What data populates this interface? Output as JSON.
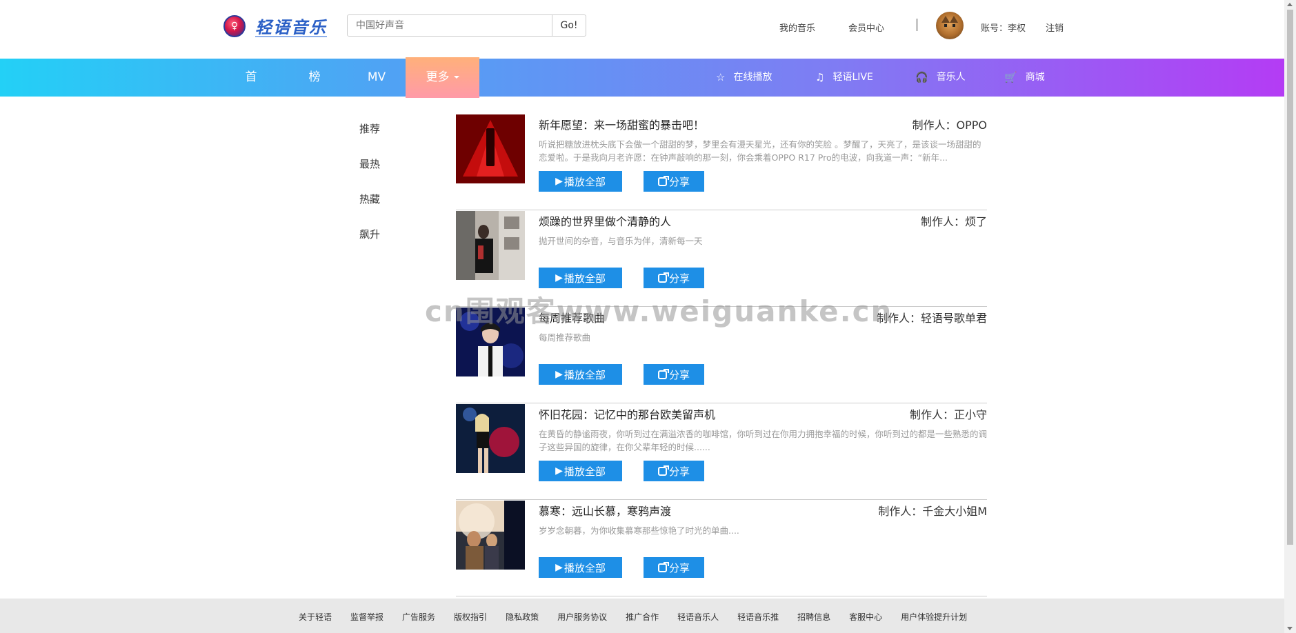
{
  "header": {
    "logo_text": "轻语音乐",
    "logo_glyph": "♀",
    "search_placeholder": "中国好声音",
    "search_button": "Go!",
    "links": {
      "my_music": "我的音乐",
      "member_center": "会员中心",
      "separator": "|",
      "account": "账号：李权",
      "logout": "注销"
    }
  },
  "nav": {
    "items": [
      "首页",
      "榜单",
      "MV"
    ],
    "more": "更多",
    "right": [
      {
        "icon": "star-icon",
        "glyph": "☆",
        "label": "在线播放"
      },
      {
        "icon": "music-note-icon",
        "glyph": "♫",
        "label": "轻语LIVE"
      },
      {
        "icon": "headphones-icon",
        "glyph": "🎧",
        "label": "音乐人"
      },
      {
        "icon": "cart-icon",
        "glyph": "🛒",
        "label": "商城"
      }
    ],
    "gradient": [
      "#23d0f6",
      "#b43cf4"
    ]
  },
  "side_menu": [
    "推荐",
    "最热",
    "热藏",
    "飙升"
  ],
  "playlists": [
    {
      "title": "新年愿望：来一场甜蜜的暴击吧！",
      "producer": "制作人：OPPO",
      "desc": "听说把糖放进枕头底下会做一个甜甜的梦，梦里会有漫天星光，还有你的笑脸 。梦醒了，天亮了，是该谈一场甜甜的恋爱啦。于是我向月老许愿：在钟声敲响的那一刻，你会乘着OPPO R17 Pro的电波，向我道一声：“新年..."
    },
    {
      "title": "烦躁的世界里做个清静的人",
      "producer": "制作人：烦了",
      "desc": "抛开世间的杂音，与音乐为伴，清新每一天"
    },
    {
      "title": "每周推荐歌曲",
      "producer": "制作人：轻语号歌单君",
      "desc": "每周推荐歌曲"
    },
    {
      "title": "怀旧花园：记忆中的那台欧美留声机",
      "producer": "制作人：正小守",
      "desc": "在黄昏的静谧雨夜，你听到过在满溢浓香的咖啡馆，你听到过在你用力拥抱幸福的时候，你听到过的都是一些熟悉的调子这些异国的旋律，在你父辈年轻的时候......"
    },
    {
      "title": "慕寒：远山长慕，寒鸦声渡",
      "producer": "制作人：千金大小姐M",
      "desc": "岁岁念朝暮，为你收集慕寒那些惊艳了时光的单曲...."
    }
  ],
  "buttons": {
    "play_all": "播放全部",
    "play_glyph": "▶",
    "share": "分享"
  },
  "watermark": "cn围观客www.weiguanke.cn",
  "footer": [
    "关于轻语",
    "监督举报",
    "广告服务",
    "版权指引",
    "隐私政策",
    "用户服务协议",
    "推广合作",
    "轻语音乐人",
    "轻语音乐推",
    "招聘信息",
    "客服中心",
    "用户体验提升计划"
  ],
  "accent": "#1e8fe6"
}
